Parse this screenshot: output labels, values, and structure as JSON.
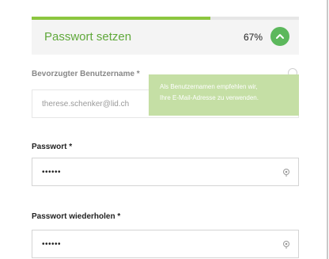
{
  "header": {
    "title": "Passwort setzen",
    "progress_text": "67%",
    "progress_value": 0.67,
    "collapse_icon": "chevron-up-icon",
    "accent_color": "#8cc63f",
    "button_color": "#5cb85c"
  },
  "username": {
    "label": "Bevorzugter Benutzername *",
    "value": "therese.schenker@lid.ch",
    "help_icon": "help-icon"
  },
  "tooltip": {
    "line1": "Als Benutzernamen empfehlen wir,",
    "line2": "Ihre E-Mail-Adresse zu verwenden."
  },
  "password": {
    "label": "Passwort *",
    "value": "••••••",
    "reveal_icon": "eye-icon"
  },
  "password_repeat": {
    "label": "Passwort wiederholen *",
    "value": "••••••",
    "reveal_icon": "eye-icon"
  }
}
